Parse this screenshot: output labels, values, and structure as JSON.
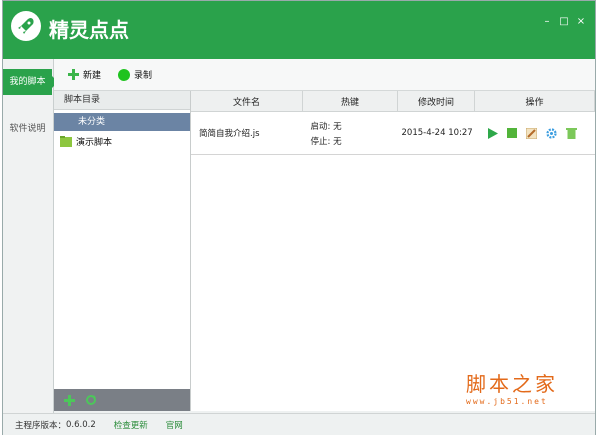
{
  "app": {
    "title": "精灵点点"
  },
  "window": {
    "minimize": "–",
    "maximize": "□",
    "close": "×"
  },
  "nav": {
    "my_scripts": "我的脚本",
    "software_doc": "软件说明"
  },
  "toolbar": {
    "new_label": "新建",
    "record_label": "录制"
  },
  "left_panel": {
    "header": "脚本目录",
    "folders": [
      "未分类",
      "演示脚本"
    ]
  },
  "table": {
    "headers": [
      "文件名",
      "热键",
      "修改时间",
      "操作"
    ],
    "rows": [
      {
        "filename": "简简自我介绍.js",
        "hotkey_start": "启动: 无",
        "hotkey_stop": "停止: 无",
        "modified": "2015-4-24 10:27"
      }
    ],
    "op_icons": [
      "play-icon",
      "stop-icon",
      "edit-icon",
      "settings-icon",
      "delete-icon"
    ]
  },
  "status": {
    "version_label": "主程序版本：",
    "version": "0.6.0.2",
    "check_update": "检查更新",
    "website": "官网"
  },
  "watermark": {
    "title": "脚本之家",
    "url": "www.jb51.net"
  },
  "colors": {
    "brand": "#2aa24b",
    "selected": "#6b84a4",
    "watermark": "#e36a1a"
  }
}
